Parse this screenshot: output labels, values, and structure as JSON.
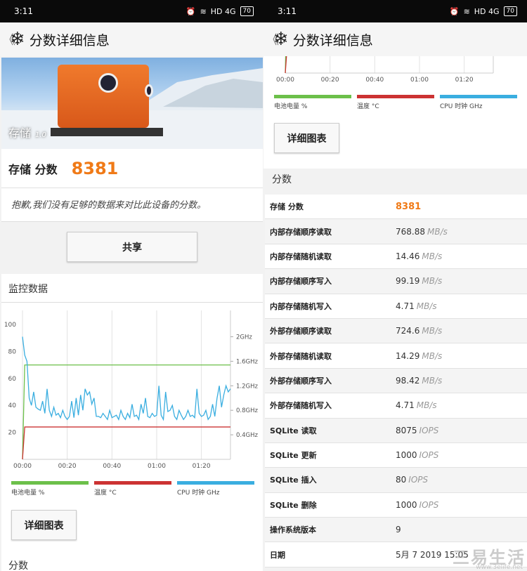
{
  "status": {
    "time": "3:11",
    "network": "HD 4G",
    "battery": "70"
  },
  "appbar": {
    "title": "分数详细信息"
  },
  "hero": {
    "label": "存储",
    "version": "1.0"
  },
  "score": {
    "label": "存储 分数",
    "value": "8381",
    "note": "抱歉,我们没有足够的数据来对比此设备的分数。"
  },
  "share_label": "共享",
  "monitor": {
    "title": "监控数据"
  },
  "detail_button": "详细图表",
  "section_score": "分数",
  "chart_data": {
    "type": "line",
    "x_ticks": [
      "00:00",
      "00:20",
      "00:40",
      "01:00",
      "01:20"
    ],
    "y_ticks_left": [
      "100",
      "80",
      "60",
      "40",
      "20"
    ],
    "y_ticks_right": [
      "2GHz",
      "1.6GHz",
      "1.2GHz",
      "0.8GHz",
      "0.4GHz"
    ],
    "legend": [
      {
        "name": "电池电量 %",
        "color": "#6cc04a"
      },
      {
        "name": "温度 °C",
        "color": "#cc3333"
      },
      {
        "name": "CPU 时钟 GHz",
        "color": "#3aaee0"
      }
    ],
    "series": [
      {
        "name": "电池电量 %",
        "color": "#6cc04a",
        "x": [
          0,
          1,
          93
        ],
        "values": [
          0,
          70,
          70
        ]
      },
      {
        "name": "温度 °C",
        "color": "#cc3333",
        "x": [
          0,
          1,
          93
        ],
        "values": [
          0,
          24,
          24
        ]
      },
      {
        "name": "CPU 时钟 GHz",
        "color": "#3aaee0",
        "x": [
          0,
          1,
          2,
          3,
          4,
          5,
          6,
          7,
          8,
          9,
          10,
          11,
          12,
          13,
          14,
          15,
          16,
          17,
          18,
          19,
          20,
          21,
          22,
          23,
          24,
          25,
          26,
          27,
          28,
          29,
          30,
          31,
          32,
          33,
          34,
          35,
          36,
          37,
          38,
          39,
          40,
          41,
          42,
          43,
          44,
          45,
          46,
          47,
          48,
          49,
          50,
          51,
          52,
          53,
          54,
          55,
          56,
          57,
          58,
          59,
          60,
          61,
          62,
          63,
          64,
          65,
          66,
          67,
          68,
          69,
          70,
          71,
          72,
          73,
          74,
          75,
          76,
          77,
          78,
          79,
          80,
          81,
          82,
          83,
          84,
          85,
          86,
          87,
          88,
          89,
          90,
          91,
          92,
          93
        ],
        "values": [
          2.0,
          1.7,
          1.6,
          1.0,
          0.88,
          1.1,
          0.85,
          0.82,
          0.8,
          0.95,
          0.75,
          1.15,
          0.8,
          0.7,
          0.85,
          0.72,
          0.75,
          0.68,
          0.8,
          0.7,
          0.65,
          0.7,
          0.95,
          0.68,
          1.0,
          0.72,
          1.05,
          0.8,
          1.15,
          1.05,
          1.1,
          0.9,
          1.0,
          0.7,
          0.7,
          0.68,
          0.75,
          0.7,
          0.65,
          0.8,
          0.68,
          0.7,
          0.72,
          0.65,
          0.8,
          0.7,
          0.65,
          0.75,
          0.68,
          0.9,
          0.7,
          0.72,
          0.65,
          0.9,
          0.75,
          1.0,
          0.7,
          0.68,
          0.75,
          0.7,
          0.72,
          1.2,
          0.72,
          0.65,
          1.1,
          0.78,
          0.8,
          0.88,
          0.7,
          0.65,
          0.8,
          0.72,
          0.65,
          0.7,
          0.8,
          0.7,
          0.72,
          0.68,
          1.15,
          0.75,
          0.7,
          0.72,
          0.8,
          0.65,
          0.7,
          0.9,
          0.7,
          1.0,
          1.2,
          0.85,
          1.05,
          1.2,
          1.1,
          1.15
        ]
      }
    ],
    "xlim": [
      0,
      93
    ],
    "ylim_left": [
      0,
      100
    ],
    "ylim_right": [
      0,
      2.2
    ]
  },
  "table": [
    {
      "name": "存储 分数",
      "value": "8381",
      "unit": "",
      "highlight": true
    },
    {
      "name": "内部存储顺序读取",
      "value": "768.88",
      "unit": "MB/s"
    },
    {
      "name": "内部存储随机读取",
      "value": "14.46",
      "unit": "MB/s"
    },
    {
      "name": "内部存储顺序写入",
      "value": "99.19",
      "unit": "MB/s"
    },
    {
      "name": "内部存储随机写入",
      "value": "4.71",
      "unit": "MB/s"
    },
    {
      "name": "外部存储顺序读取",
      "value": "724.6",
      "unit": "MB/s"
    },
    {
      "name": "外部存储随机读取",
      "value": "14.29",
      "unit": "MB/s"
    },
    {
      "name": "外部存储顺序写入",
      "value": "98.42",
      "unit": "MB/s"
    },
    {
      "name": "外部存储随机写入",
      "value": "4.71",
      "unit": "MB/s"
    },
    {
      "name": "SQLite 读取",
      "value": "8075",
      "unit": "IOPS"
    },
    {
      "name": "SQLite 更新",
      "value": "1000",
      "unit": "IOPS"
    },
    {
      "name": "SQLite 插入",
      "value": "80",
      "unit": "IOPS"
    },
    {
      "name": "SQLite 删除",
      "value": "1000",
      "unit": "IOPS"
    },
    {
      "name": "操作系统版本",
      "value": "9",
      "unit": ""
    },
    {
      "name": "日期",
      "value": "5月 7 2019 15:05",
      "unit": ""
    }
  ],
  "watermark": {
    "brand": "三易生活",
    "url": "www.3elife.net"
  }
}
